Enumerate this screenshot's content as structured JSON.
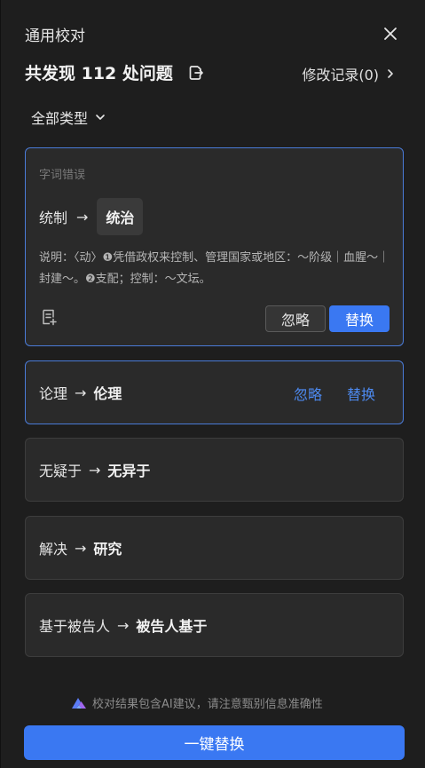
{
  "header": {
    "title": "通用校对",
    "summary": "共发现 112 处问题",
    "history": "修改记录(0)"
  },
  "filter": {
    "label": "全部类型"
  },
  "issues": [
    {
      "type": "字词错误",
      "from": "统制",
      "arrow": "→",
      "to": "统治",
      "desc": "说明：〈动〉❶凭借政权来控制、管理国家或地区：～阶级｜血腥～｜封建～。❷支配；控制：～文坛。",
      "ignore": "忽略",
      "replace": "替换"
    },
    {
      "from": "论理",
      "arrow": "→",
      "to": "伦理",
      "ignore": "忽略",
      "replace": "替换"
    },
    {
      "from": "无疑于",
      "arrow": "→",
      "to": "无异于"
    },
    {
      "from": "解决",
      "arrow": "→",
      "to": "研究"
    },
    {
      "from": "基于被告人",
      "arrow": "→",
      "to": "被告人基于"
    }
  ],
  "footer": {
    "disclaimer": "校对结果包含AI建议，请注意甄别信息准确性",
    "replace_all": "一键替换"
  },
  "colors": {
    "accent": "#3a78f2",
    "link": "#4d8af0",
    "card_bg": "#2a2a2a",
    "panel_bg": "#1e1e1e",
    "active_border": "#4a7bd8"
  },
  "icons": [
    "close-icon",
    "export-icon",
    "chevron-right-icon",
    "chevron-down-icon",
    "add-note-icon",
    "ai-logo-icon"
  ]
}
